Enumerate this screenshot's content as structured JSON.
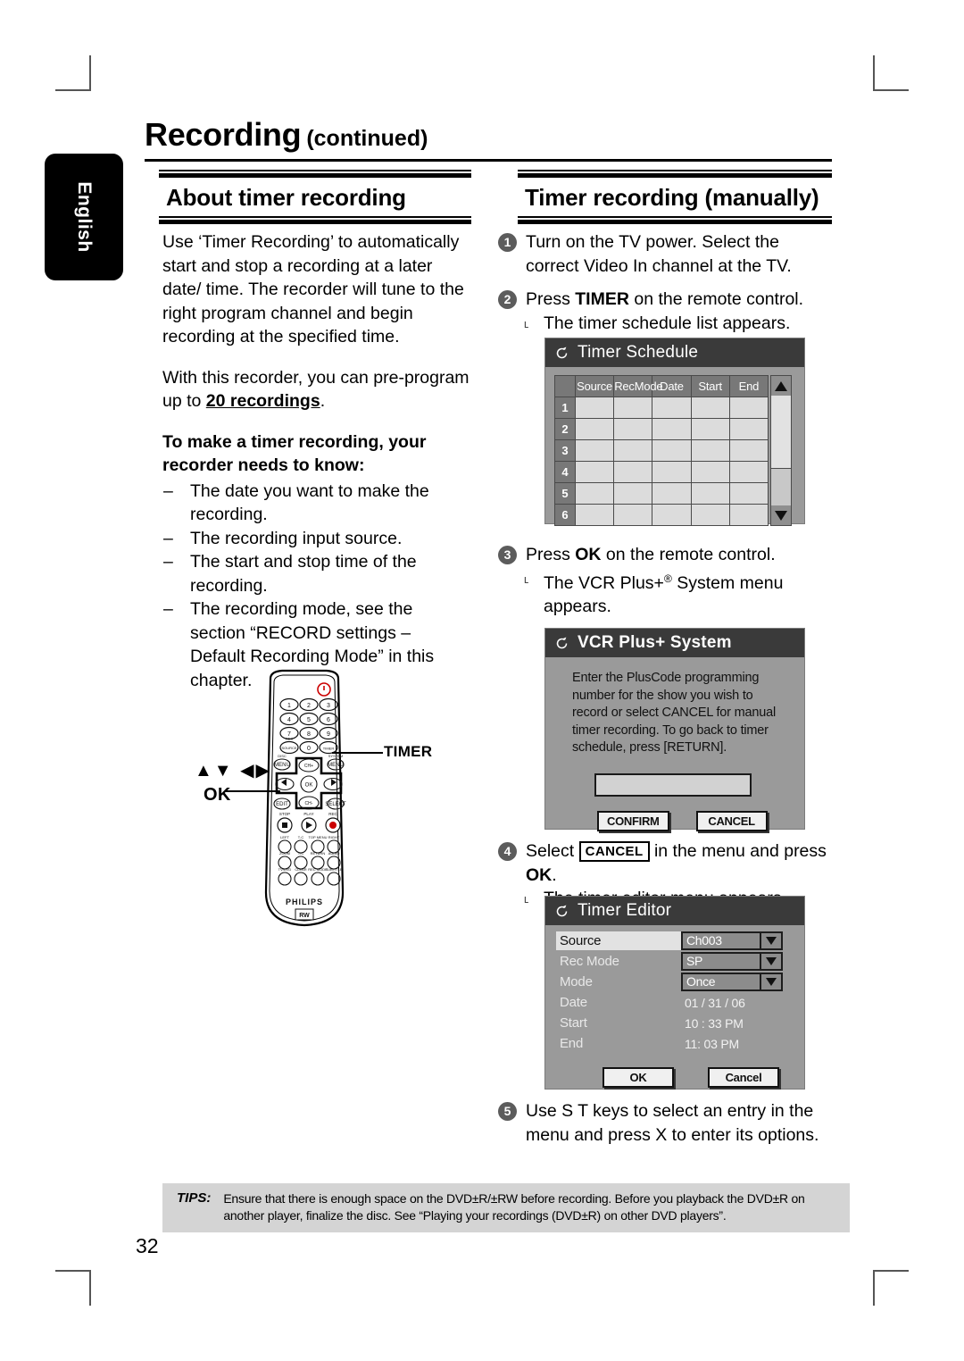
{
  "page": {
    "title_main": "Recording",
    "title_sub": "(continued)",
    "language_tab": "English",
    "page_number": "32"
  },
  "left_column": {
    "section_title": "About timer recording",
    "para1": "Use ‘Timer Recording’ to automatically start and stop a recording at a later date/ time. The recorder will tune to the right program channel and begin recording at the specified time.",
    "para2_prefix": "With this recorder, you can pre-program up to ",
    "para2_bold": "20 recordings",
    "para2_suffix": ".",
    "sub_head": "To make a timer recording, your recorder needs to know:",
    "bullets": [
      "The date you want to make the recording.",
      "The recording input source.",
      "The start and stop time of the recording.",
      "The recording mode, see the section “RECORD settings – Default Recording Mode” in this chapter."
    ],
    "dash": "–"
  },
  "remote": {
    "timer_callout": "TIMER",
    "arrows_callout": "▲▼ ◀▶",
    "ok_callout": "OK",
    "brand": "PHILIPS",
    "keypad": [
      "1",
      "2",
      "3",
      "4",
      "5",
      "6",
      "7",
      "8",
      "9",
      "0"
    ],
    "ok_button": "OK",
    "timer_button": "TIMER",
    "rec_source_label": "REC\nSOURCE"
  },
  "right_column": {
    "section_title": "Timer recording (manually)",
    "steps": [
      {
        "num": "1",
        "text": "Turn on the TV power. Select the correct Video In channel at the TV."
      },
      {
        "num": "2",
        "text_before": "Press ",
        "text_bold": "TIMER",
        "text_after": " on the remote control.",
        "sub": "The timer schedule list appears."
      },
      {
        "num": "3",
        "text_before": "Press ",
        "text_bold": "OK",
        "text_after": " on the remote control.",
        "sub_before": "The VCR Plus+",
        "sub_sup": "®",
        "sub_after": " System menu appears."
      },
      {
        "num": "4",
        "text_before": "Select ",
        "text_box": "CANCEL",
        "text_mid": " in the menu and press ",
        "text_bold": "OK",
        "text_after": ".",
        "sub": "The timer editor menu appears."
      },
      {
        "num": "5",
        "text": "Use  S T keys to select an entry in the menu and press  X to enter its options."
      }
    ]
  },
  "timer_schedule": {
    "title": "Timer Schedule",
    "columns": [
      "Source",
      "RecMode",
      "Date",
      "Start",
      "End"
    ],
    "rows": [
      "1",
      "2",
      "3",
      "4",
      "5",
      "6"
    ],
    "scroll_up_icon": "triangle-up",
    "scroll_down_icon": "triangle-down"
  },
  "vcr_plus": {
    "title": "VCR Plus+ System",
    "message": "Enter the PlusCode programming number for the show you wish to record or select CANCEL for manual timer recording. To go back to timer schedule, press [RETURN].",
    "input_value": "",
    "confirm_label": "CONFIRM",
    "cancel_label": "CANCEL"
  },
  "timer_editor": {
    "title": "Timer Editor",
    "fields": [
      {
        "label": "Source",
        "value": "Ch003",
        "type": "select",
        "selected": true
      },
      {
        "label": "Rec Mode",
        "value": "SP",
        "type": "select",
        "selected": false
      },
      {
        "label": "Mode",
        "value": "Once",
        "type": "select",
        "selected": false
      },
      {
        "label": "Date",
        "value": "01 / 31 / 06",
        "type": "text",
        "selected": false
      },
      {
        "label": "Start",
        "value": "10 : 33 PM",
        "type": "text",
        "selected": false
      },
      {
        "label": "End",
        "value": "11: 03 PM",
        "type": "text",
        "selected": false
      }
    ],
    "ok_label": "OK",
    "cancel_label": "Cancel"
  },
  "tips": {
    "label": "TIPS:",
    "text": "Ensure that there is enough space on the DVD±R/±RW before recording. Before you playback the DVD±R on another player, finalize the disc. See “Playing your recordings (DVD±R) on other DVD players”."
  },
  "colors": {
    "osd_header": "#3a3a3a",
    "osd_body": "#9a9a9a",
    "tips_band": "#d4d4d4",
    "step_badge": "#5c5c5c"
  }
}
